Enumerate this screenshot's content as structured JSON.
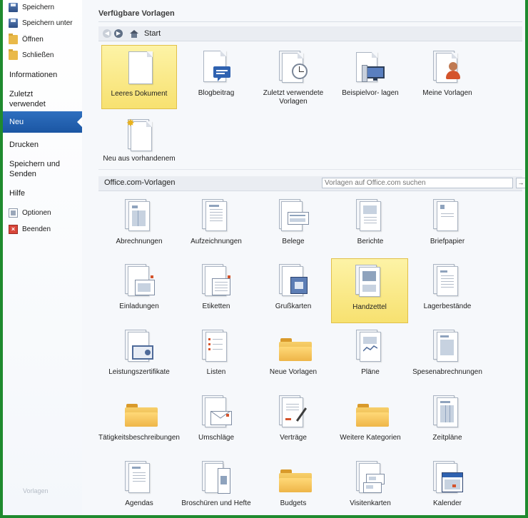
{
  "sidebar": {
    "items_small_top": [
      {
        "label": "Speichern",
        "icon": "save-icon"
      },
      {
        "label": "Speichern unter",
        "icon": "save-as-icon"
      },
      {
        "label": "Öffnen",
        "icon": "open-folder-icon"
      },
      {
        "label": "Schließen",
        "icon": "close-folder-icon"
      }
    ],
    "informationen": "Informationen",
    "zuletzt": "Zuletzt verwendet",
    "neu": "Neu",
    "drucken": "Drucken",
    "speichern_senden": "Speichern und Senden",
    "hilfe": "Hilfe",
    "optionen": "Optionen",
    "beenden": "Beenden",
    "footer": "Vorlagen"
  },
  "main": {
    "heading": "Verfügbare Vorlagen",
    "nav": {
      "back": "◀",
      "forward": "▶",
      "location": "Start"
    },
    "available": [
      {
        "label": "Leeres Dokument",
        "selected": true
      },
      {
        "label": "Blogbeitrag"
      },
      {
        "label": "Zuletzt verwendete Vorlagen"
      },
      {
        "label": "Beispielvor- lagen"
      },
      {
        "label": "Meine Vorlagen"
      },
      {
        "label": "Neu aus vorhandenem"
      }
    ],
    "office_section": "Office.com-Vorlagen",
    "search": {
      "placeholder": "Vorlagen auf Office.com suchen",
      "go": "→"
    },
    "office": [
      {
        "label": "Abrechnungen"
      },
      {
        "label": "Aufzeichnungen"
      },
      {
        "label": "Belege"
      },
      {
        "label": "Berichte"
      },
      {
        "label": "Briefpapier"
      },
      {
        "label": "Einladungen"
      },
      {
        "label": "Etiketten"
      },
      {
        "label": "Grußkarten"
      },
      {
        "label": "Handzettel",
        "selected": true
      },
      {
        "label": "Lagerbestände"
      },
      {
        "label": "Leistungszertifikate"
      },
      {
        "label": "Listen"
      },
      {
        "label": "Neue Vorlagen"
      },
      {
        "label": "Pläne"
      },
      {
        "label": "Spesenabrechnungen"
      },
      {
        "label": "Tätigkeitsbeschreibungen"
      },
      {
        "label": "Umschläge"
      },
      {
        "label": "Verträge"
      },
      {
        "label": "Weitere Kategorien"
      },
      {
        "label": "Zeitpläne"
      },
      {
        "label": "Agendas"
      },
      {
        "label": "Broschüren und Hefte"
      },
      {
        "label": "Budgets"
      },
      {
        "label": "Visitenkarten"
      },
      {
        "label": "Kalender"
      }
    ]
  },
  "colors": {
    "accent": "#1b56a3",
    "selection": "#f7e170",
    "frame": "#1f8a2e"
  }
}
